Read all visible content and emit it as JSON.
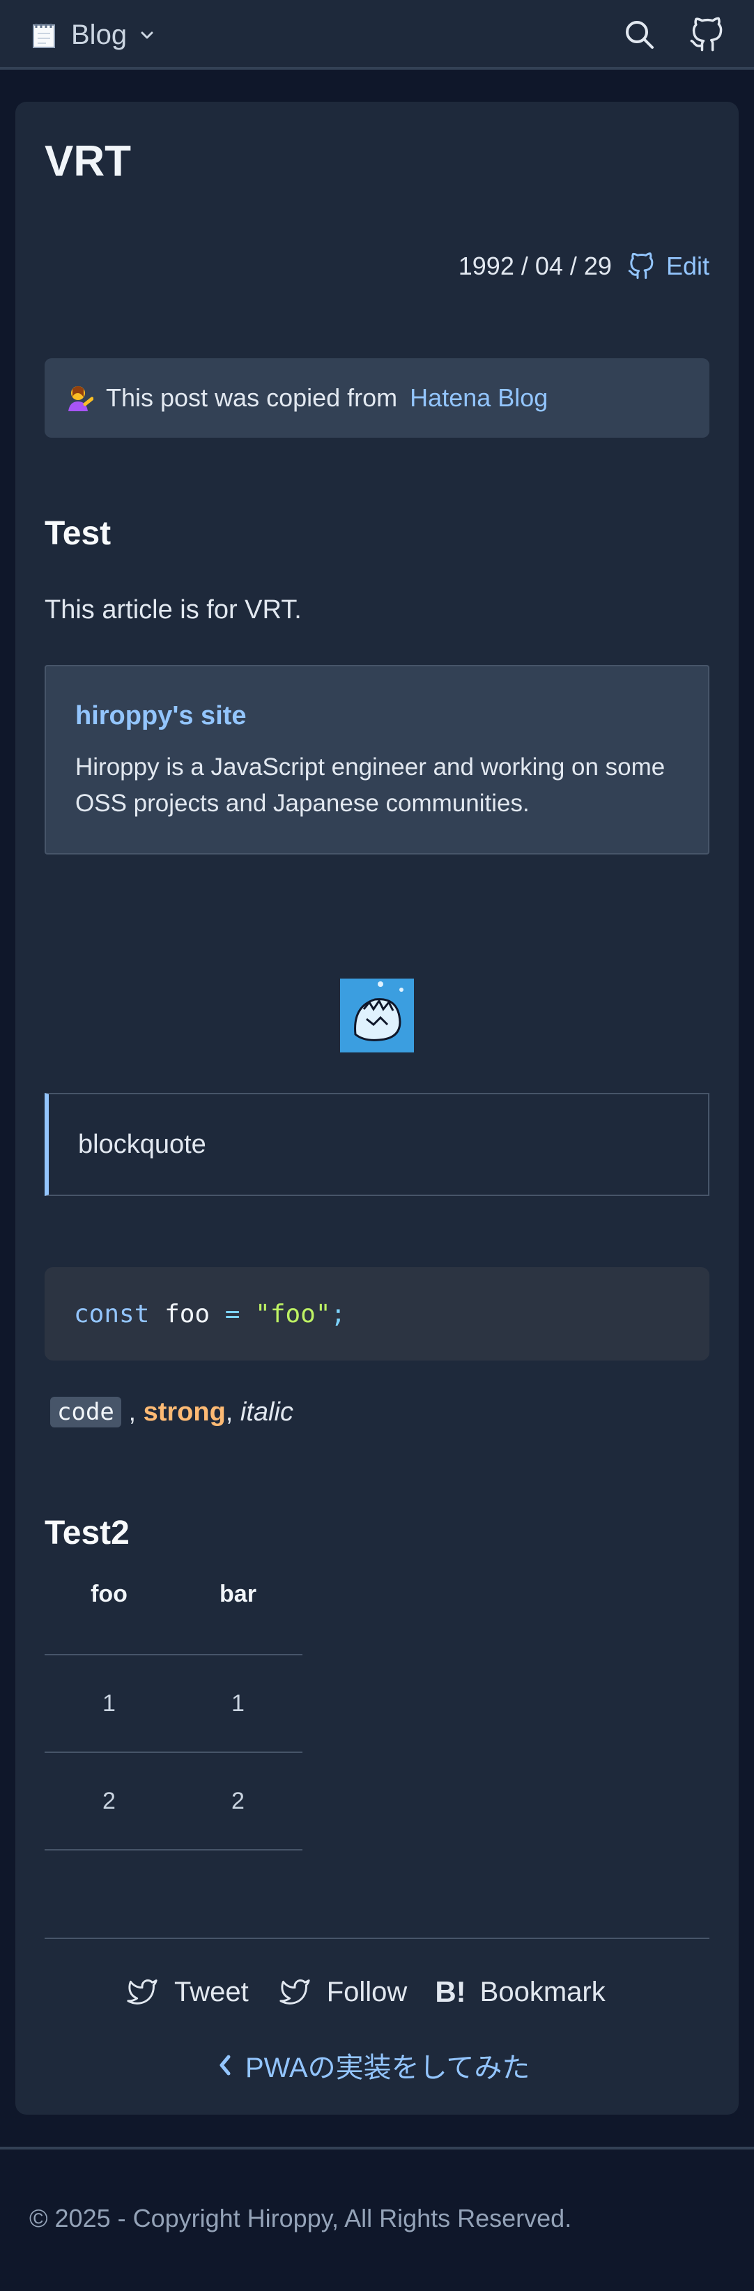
{
  "header": {
    "brand": "Blog",
    "icons": {
      "logo": "notepad-icon",
      "dropdown": "chevron-down-icon",
      "search": "search-icon",
      "github": "github-icon"
    }
  },
  "post": {
    "title": "VRT",
    "date": "1992 / 04 / 29",
    "edit_label": "Edit",
    "notice_prefix": "This post was copied from",
    "notice_link": "Hatena Blog",
    "heading1": "Test",
    "paragraph": "This article is for VRT.",
    "link_card": {
      "title": "hiroppy's site",
      "description": "Hiroppy is a JavaScript engineer and working on some OSS projects and Japanese communities."
    },
    "blockquote": "blockquote",
    "code": {
      "keyword": "const",
      "identifier": "foo",
      "operator": "=",
      "string": "\"foo\"",
      "semicolon": ";"
    },
    "inline": {
      "code": "code",
      "sep1": " , ",
      "strong": "strong",
      "sep2": ", ",
      "italic": "italic"
    },
    "heading2": "Test2",
    "table": {
      "headers": [
        "foo",
        "bar"
      ],
      "rows": [
        [
          "1",
          "1"
        ],
        [
          "2",
          "2"
        ]
      ]
    }
  },
  "share": {
    "tweet": "Tweet",
    "follow": "Follow",
    "bookmark": "Bookmark",
    "bookmark_icon": "B!"
  },
  "prev_post": "PWAの実装をしてみた",
  "footer": "© 2025 - Copyright Hiroppy, All Rights Reserved.",
  "colors": {
    "background": "#0f172a",
    "card": "#1e293b",
    "accent": "#93c5fd",
    "strong": "#fdba74"
  }
}
